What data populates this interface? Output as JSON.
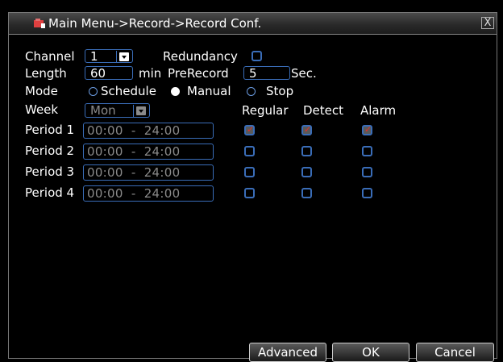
{
  "window": {
    "title": "Main Menu->Record->Record Conf.",
    "close_symbol": "X"
  },
  "form": {
    "channel_label": "Channel",
    "channel_value": "1",
    "redundancy_label": "Redundancy",
    "redundancy_checked": false,
    "length_label": "Length",
    "length_value": "60",
    "length_unit": "min",
    "prerecord_label": "PreRecord",
    "prerecord_value": "5",
    "prerecord_unit": "Sec.",
    "mode_label": "Mode",
    "mode_options": [
      "Schedule",
      "Manual",
      "Stop"
    ],
    "mode_selected": "Manual",
    "week_label": "Week",
    "week_value": "Mon",
    "col_regular": "Regular",
    "col_detect": "Detect",
    "col_alarm": "Alarm",
    "periods": [
      {
        "label": "Period 1",
        "range": "00:00  -  24:00",
        "regular": true,
        "detect": true,
        "alarm": true
      },
      {
        "label": "Period 2",
        "range": "00:00  -  24:00",
        "regular": false,
        "detect": false,
        "alarm": false
      },
      {
        "label": "Period 3",
        "range": "00:00  -  24:00",
        "regular": false,
        "detect": false,
        "alarm": false
      },
      {
        "label": "Period 4",
        "range": "00:00  -  24:00",
        "regular": false,
        "detect": false,
        "alarm": false
      }
    ]
  },
  "buttons": {
    "advanced": "Advanced",
    "ok": "OK",
    "cancel": "Cancel"
  },
  "colors": {
    "accent_border": "#3a6db8",
    "check_mark": "#e03030",
    "background": "#000000"
  }
}
